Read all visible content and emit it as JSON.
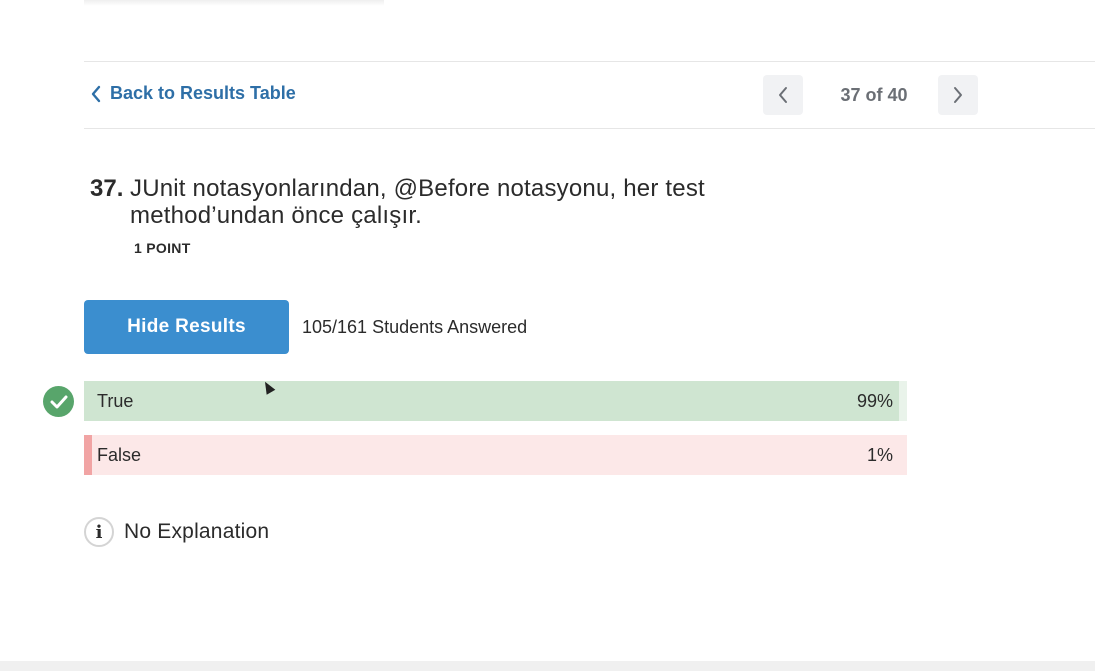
{
  "navigation": {
    "back_label": "Back to Results Table",
    "pager_text": "37 of 40"
  },
  "question": {
    "number": "37.",
    "text": "JUnit notasyonlarından, @Before notasyonu, her test method’undan önce çalışır.",
    "points": "1 POINT"
  },
  "results": {
    "hide_button_label": "Hide Results",
    "answered_text": "105/161 Students Answered",
    "options": [
      {
        "label": "True",
        "percent_text": "99%",
        "percent": 99,
        "correct": true
      },
      {
        "label": "False",
        "percent_text": "1%",
        "percent": 1,
        "correct": false
      }
    ]
  },
  "explanation": {
    "text": "No Explanation"
  },
  "colors": {
    "accent": "#3b8ecf",
    "link": "#2e6fa7",
    "correct": "#58a56b",
    "true_bar": "#cfe5d1",
    "false_bar": "#f1a4a4"
  },
  "icons": {
    "back": "chevron-left-icon",
    "prev": "chevron-left-icon",
    "next": "chevron-right-icon",
    "correct": "check-circle-icon",
    "info": "info-icon"
  }
}
